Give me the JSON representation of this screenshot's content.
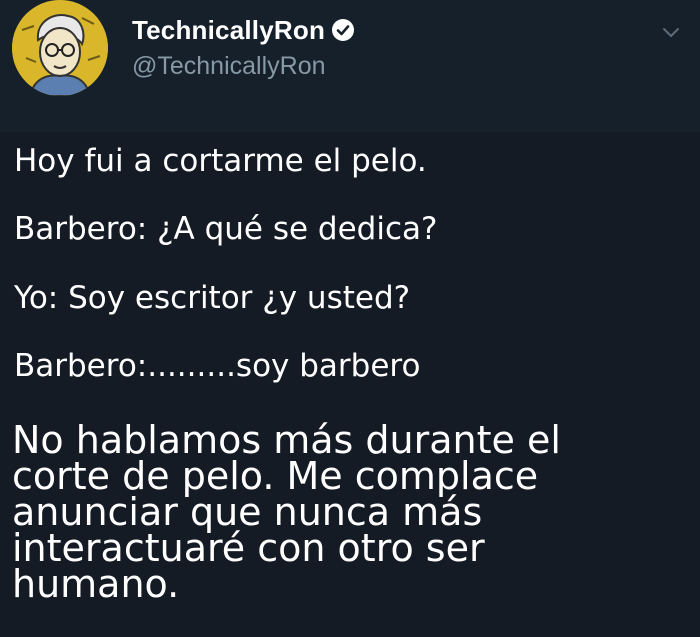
{
  "profile": {
    "display_name": "TechnicallyRon",
    "handle": "@TechnicallyRon",
    "verified": true,
    "avatar_bg": "#d9b62a"
  },
  "tweet": {
    "lines": [
      "Hoy fui a cortarme el pelo.",
      "Barbero: ¿A qué se dedica?",
      "Yo: Soy escritor ¿y usted?",
      "Barbero:.........soy barbero"
    ],
    "closing_lines": [
      "No hablamos más durante el",
      "corte de pelo. Me complace",
      "anunciar que nunca más",
      "interactuaré con otro ser",
      "humano."
    ]
  },
  "icons": {
    "verified": "verified-badge-icon",
    "more": "chevron-down-icon"
  },
  "colors": {
    "background": "#15202b",
    "text": "#ffffff",
    "handle": "#8899a6"
  }
}
